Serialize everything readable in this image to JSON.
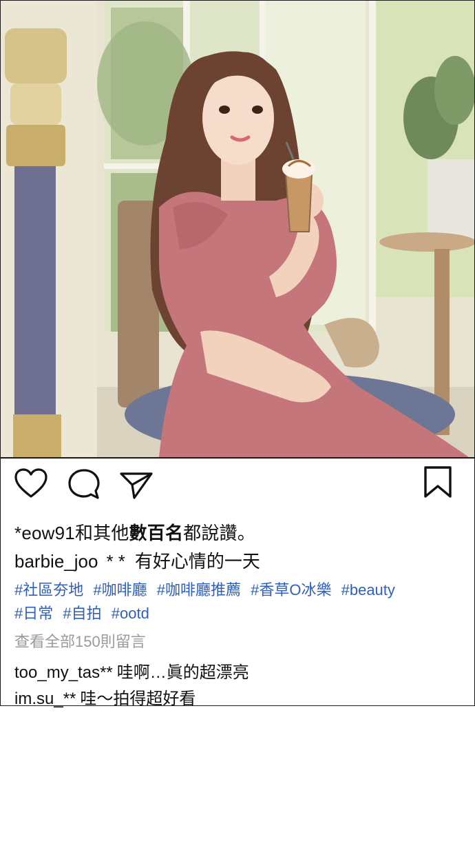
{
  "post": {
    "likes_user": "*eow91",
    "likes_text_1": "和其他",
    "likes_text_bold": "數百名",
    "likes_text_2": "都說讚。",
    "author": "barbie_joo",
    "author_suffix": "* *",
    "caption": "有好心情的一天",
    "hashtags": [
      "#社區夯地",
      "#咖啡廳",
      "#咖啡廳推薦",
      "#香草O冰樂",
      "#beauty",
      "#日常",
      "#自拍",
      "#ootd"
    ],
    "view_all_comments": "查看全部150則留言",
    "comments": [
      {
        "user": "too_my_tas**",
        "text": "哇啊…眞的超漂亮"
      },
      {
        "user": "im.su_**",
        "text": "哇～拍得超好看"
      }
    ]
  },
  "icons": {
    "like": "heart-icon",
    "comment": "comment-bubble-icon",
    "share": "paper-plane-icon",
    "save": "bookmark-icon"
  },
  "colors": {
    "hashtag": "#2f5fb8",
    "muted": "#9a9a9a",
    "dress": "#c4767a"
  }
}
